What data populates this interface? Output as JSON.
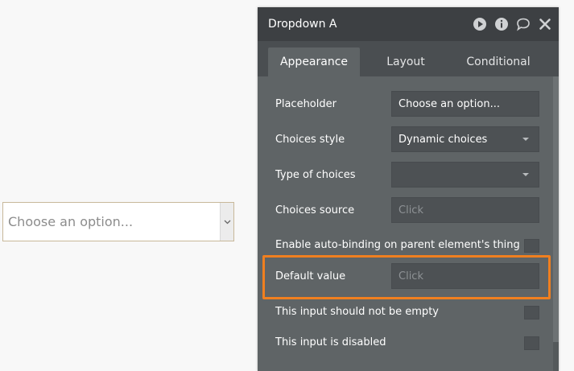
{
  "canvas": {
    "dropdown_placeholder": "Choose an option..."
  },
  "panel": {
    "title": "Dropdown A",
    "header_icons": [
      "play-icon",
      "info-icon",
      "comment-icon",
      "close-icon"
    ],
    "tabs": [
      {
        "label": "Appearance",
        "active": true
      },
      {
        "label": "Layout",
        "active": false
      },
      {
        "label": "Conditional",
        "active": false
      }
    ],
    "fields": {
      "placeholder": {
        "label": "Placeholder",
        "value": "Choose an option..."
      },
      "choices_style": {
        "label": "Choices style",
        "value": "Dynamic choices"
      },
      "type_of_choices": {
        "label": "Type of choices",
        "value": ""
      },
      "choices_source": {
        "label": "Choices source",
        "value": "Click"
      },
      "auto_binding": {
        "label": "Enable auto-binding on parent element's thing",
        "checked": false
      },
      "default_value": {
        "label": "Default value",
        "value": "Click"
      },
      "not_empty": {
        "label": "This input should not be empty",
        "checked": false
      },
      "disabled": {
        "label": "This input is disabled",
        "checked": false
      }
    }
  },
  "colors": {
    "panel_bg": "#5f6466",
    "header_bg": "#3d4043",
    "highlight": "#f07f1f"
  }
}
